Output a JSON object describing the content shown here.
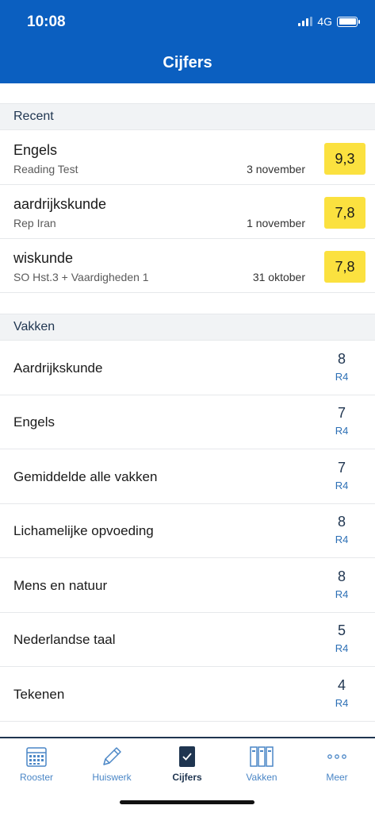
{
  "status_bar": {
    "time": "10:08",
    "network": "4G"
  },
  "header": {
    "title": "Cijfers"
  },
  "recent": {
    "title": "Recent",
    "items": [
      {
        "subject": "Engels",
        "description": "Reading Test",
        "date": "3 november",
        "grade": "9,3"
      },
      {
        "subject": "aardrijkskunde",
        "description": "Rep Iran",
        "date": "1 november",
        "grade": "7,8"
      },
      {
        "subject": "wiskunde",
        "description": "SO Hst.3 + Vaardigheden 1",
        "date": "31 oktober",
        "grade": "7,8"
      }
    ]
  },
  "subjects": {
    "title": "Vakken",
    "items": [
      {
        "name": "Aardrijkskunde",
        "grade": "8",
        "period": "R4"
      },
      {
        "name": "Engels",
        "grade": "7",
        "period": "R4"
      },
      {
        "name": "Gemiddelde alle vakken",
        "grade": "7",
        "period": "R4"
      },
      {
        "name": "Lichamelijke opvoeding",
        "grade": "8",
        "period": "R4"
      },
      {
        "name": "Mens en natuur",
        "grade": "8",
        "period": "R4"
      },
      {
        "name": "Nederlandse taal",
        "grade": "5",
        "period": "R4"
      },
      {
        "name": "Tekenen",
        "grade": "4",
        "period": "R4"
      }
    ]
  },
  "tabbar": {
    "items": [
      {
        "label": "Rooster",
        "icon": "calendar-icon"
      },
      {
        "label": "Huiswerk",
        "icon": "pencil-icon"
      },
      {
        "label": "Cijfers",
        "icon": "grades-notebook-icon",
        "active": true
      },
      {
        "label": "Vakken",
        "icon": "binders-icon"
      },
      {
        "label": "Meer",
        "icon": "more-dots-icon"
      }
    ]
  },
  "colors": {
    "header": "#0b5fc0",
    "grade_badge": "#fbe13f",
    "accent": "#4a86c6",
    "text_dark": "#1f3550"
  }
}
